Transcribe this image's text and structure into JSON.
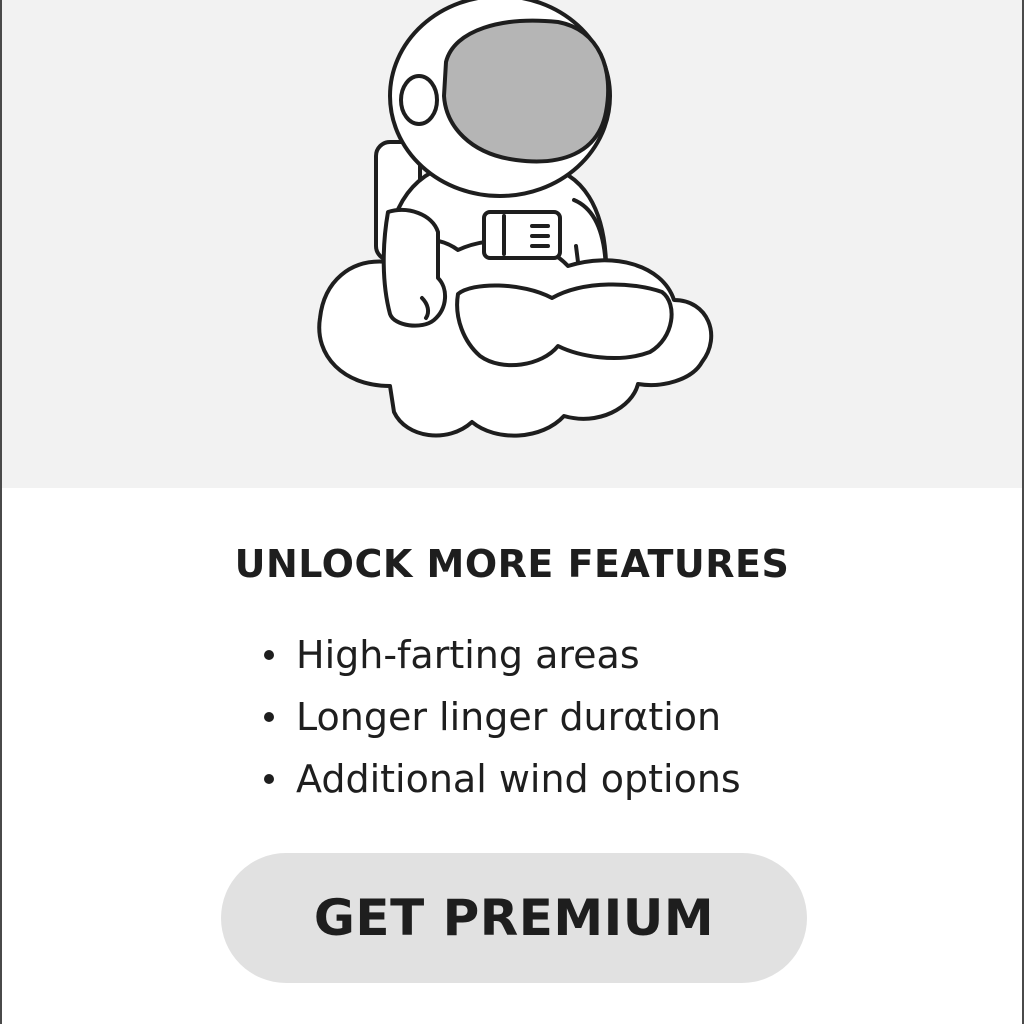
{
  "hero": {
    "illustration": "astronaut-on-cloud",
    "background": "#f2f2f2"
  },
  "paywall": {
    "title": "UNLOCK MORE FEATURES",
    "features": [
      "High-farting areas",
      "Longer linger durαtion",
      "Additional wind options"
    ],
    "cta_label": "GET PREMIUM"
  },
  "colors": {
    "text": "#1e1e1e",
    "button_bg": "#e1e1e1",
    "visor": "#b5b5b5"
  }
}
